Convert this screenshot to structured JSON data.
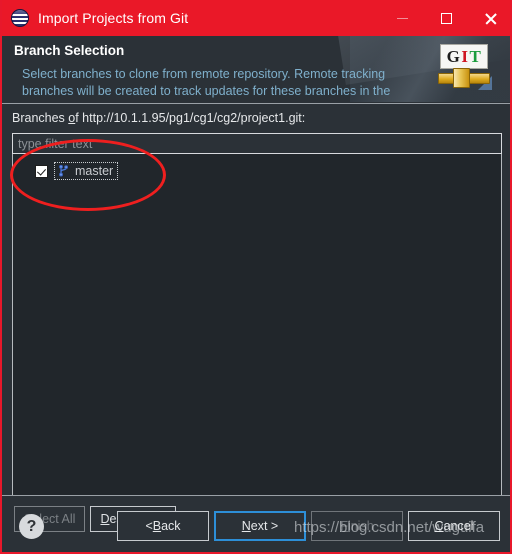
{
  "window": {
    "title": "Import Projects from Git",
    "icon": "eclipse-icon",
    "controls": {
      "minimize": "minimize-icon",
      "maximize": "maximize-icon",
      "close": "close-icon"
    }
  },
  "header": {
    "title": "Branch Selection",
    "description": "Select branches to clone from remote repository. Remote tracking branches will be created to track updates for these branches in the",
    "logo": {
      "g": "G",
      "i": "I",
      "t": "T"
    }
  },
  "main": {
    "branches_label_prefix": "Branches ",
    "branches_label_mnemonic": "o",
    "branches_label_suffix": "f http://10.1.1.95/pg1/cg1/cg2/project1.git:",
    "filter": {
      "value": "",
      "placeholder": "type filter text"
    },
    "branches": [
      {
        "name": "master",
        "checked": true,
        "icon": "git-branch-icon",
        "focused": true
      }
    ],
    "select_all": {
      "label": "Select All",
      "mnemonic": "S",
      "rest": "elect All",
      "enabled": false
    },
    "deselect_all": {
      "label": "Deselect All",
      "mnemonic": "D",
      "rest": "eselect All",
      "enabled": true
    }
  },
  "footer": {
    "help": "?",
    "buttons": [
      {
        "name": "back",
        "prefix": "< ",
        "mnemonic": "B",
        "suffix": "ack",
        "enabled": true,
        "default": false
      },
      {
        "name": "next",
        "prefix": "",
        "mnemonic": "N",
        "suffix": "ext >",
        "enabled": true,
        "default": true
      },
      {
        "name": "finish",
        "prefix": "",
        "mnemonic": "F",
        "suffix": "inish",
        "enabled": false,
        "default": false
      },
      {
        "name": "cancel",
        "prefix": "",
        "mnemonic": "C",
        "suffix": "ancel",
        "enabled": true,
        "default": false
      }
    ]
  },
  "annotation": {
    "shape": "red-ellipse-highlight"
  },
  "watermark": "https://blog.csdn.net/wuguifa",
  "colors": {
    "titlebar": "#ea1828",
    "dialog_bg": "#2b3137",
    "list_bg": "#21262b",
    "desc_text": "#7fb0cc",
    "annotation": "#ef1f1f",
    "focus_border": "#2d8fd8"
  }
}
